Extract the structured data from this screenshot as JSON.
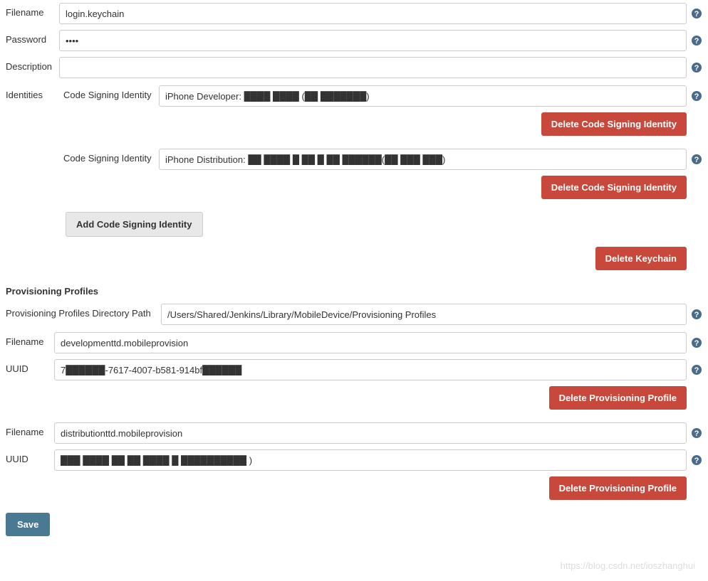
{
  "keychain": {
    "filename_label": "Filename",
    "filename_value": "login.keychain",
    "password_label": "Password",
    "password_value": "••••",
    "description_label": "Description",
    "description_value": "",
    "identities_label": "Identities",
    "identities": [
      {
        "label": "Code Signing Identity",
        "value": "iPhone Developer: ████ ████ (██ ███████)",
        "delete_label": "Delete Code Signing Identity"
      },
      {
        "label": "Code Signing Identity",
        "value": "iPhone Distribution: ██ ████ █ ██ █ ██ ██████(██ ███ ███)",
        "delete_label": "Delete Code Signing Identity"
      }
    ],
    "add_identity_label": "Add Code Signing Identity",
    "delete_keychain_label": "Delete Keychain"
  },
  "provisioning": {
    "section_title": "Provisioning Profiles",
    "dir_label": "Provisioning Profiles Directory Path",
    "dir_value": "/Users/Shared/Jenkins/Library/MobileDevice/Provisioning Profiles",
    "profiles": [
      {
        "filename_label": "Filename",
        "filename_value": "developmenttd.mobileprovision",
        "uuid_label": "UUID",
        "uuid_value": "7██████-7617-4007-b581-914bf██████",
        "delete_label": "Delete Provisioning Profile"
      },
      {
        "filename_label": "Filename",
        "filename_value": "distributionttd.mobileprovision",
        "uuid_label": "UUID",
        "uuid_value": "███ ████ ██ ██ ████ █ ██████████ )",
        "delete_label": "Delete Provisioning Profile"
      }
    ]
  },
  "save_label": "Save",
  "watermark": "https://blog.csdn.net/ioszhanghui"
}
